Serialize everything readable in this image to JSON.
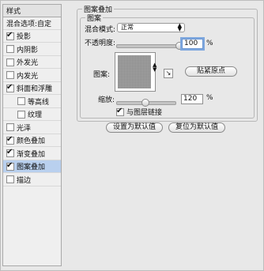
{
  "style_list": {
    "title": "样式",
    "blend_options": "混合选项:自定",
    "items": [
      {
        "label": "投影",
        "checked": true,
        "selected": false,
        "indent": false
      },
      {
        "label": "内阴影",
        "checked": false,
        "selected": false,
        "indent": false
      },
      {
        "label": "外发光",
        "checked": false,
        "selected": false,
        "indent": false
      },
      {
        "label": "内发光",
        "checked": false,
        "selected": false,
        "indent": false
      },
      {
        "label": "斜面和浮雕",
        "checked": true,
        "selected": false,
        "indent": false
      },
      {
        "label": "等高线",
        "checked": false,
        "selected": false,
        "indent": true
      },
      {
        "label": "纹理",
        "checked": false,
        "selected": false,
        "indent": true
      },
      {
        "label": "光泽",
        "checked": false,
        "selected": false,
        "indent": false
      },
      {
        "label": "颜色叠加",
        "checked": true,
        "selected": false,
        "indent": false
      },
      {
        "label": "渐变叠加",
        "checked": true,
        "selected": false,
        "indent": false
      },
      {
        "label": "图案叠加",
        "checked": true,
        "selected": true,
        "indent": false
      },
      {
        "label": "描边",
        "checked": false,
        "selected": false,
        "indent": false
      }
    ]
  },
  "panel": {
    "group_title": "图案叠加",
    "subgroup_title": "图案",
    "blend_mode_label": "混合模式:",
    "blend_mode_value": "正常",
    "opacity_label": "不透明度:",
    "opacity_value": "100",
    "opacity_fraction": 1.0,
    "percent": "%",
    "pattern_label": "图案:",
    "snap_origin_button": "贴紧原点",
    "scale_label": "缩放:",
    "scale_value": "120",
    "scale_fraction": 0.2,
    "link_with_layer_label": "与图层链接",
    "link_with_layer_checked": true
  },
  "buttons": {
    "make_default": "设置为默认值",
    "reset_default": "复位为默认值"
  }
}
